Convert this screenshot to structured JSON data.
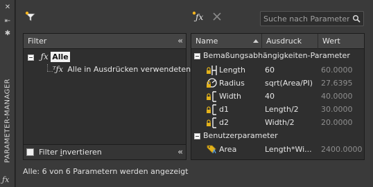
{
  "palette": {
    "dim_value": "#8e8e8e",
    "lock": "#e3b21a",
    "selection_bg": "#f2f2f2"
  },
  "side_strip": {
    "title": "PARAMETER-MANAGER"
  },
  "toolbar": {
    "search_placeholder": "Suche nach Parameter"
  },
  "filter_panel": {
    "header": "Filter",
    "tree": [
      {
        "label": "Alle",
        "selected": true
      },
      {
        "label": "Alle in Ausdrücken verwendeten"
      }
    ],
    "invert_prefix": "Filter ",
    "invert_underlined": "i",
    "invert_suffix": "nvertieren"
  },
  "grid": {
    "columns": {
      "name": "Name",
      "expression": "Ausdruck",
      "value": "Wert"
    },
    "groups": [
      {
        "title": "Bemaßungsabhängigkeiten-Parameter",
        "rows": [
          {
            "icon": "linear-constraint-lock-icon",
            "name": "Length",
            "expression": "60",
            "value": "60.0000"
          },
          {
            "icon": "radius-constraint-lock-icon",
            "name": "Radius",
            "expression": "sqrt(Area/PI)",
            "value": "27.6395"
          },
          {
            "icon": "linear-constraint-lock-icon",
            "name": "Width",
            "expression": "40",
            "value": "40.0000"
          },
          {
            "icon": "linear-constraint-lock-icon",
            "name": "d1",
            "expression": "Length/2",
            "value": "30.0000"
          },
          {
            "icon": "linear-constraint-lock-icon",
            "name": "d2",
            "expression": "Width/2",
            "value": "20.0000"
          }
        ]
      },
      {
        "title": "Benutzerparameter",
        "rows": [
          {
            "icon": "user-parameter-icon",
            "name": "Area",
            "expression": "Length*Wi...",
            "value": "2400.0000"
          }
        ]
      }
    ]
  },
  "status": {
    "text": "Alle: 6 von 6 Parametern werden angezeigt"
  }
}
